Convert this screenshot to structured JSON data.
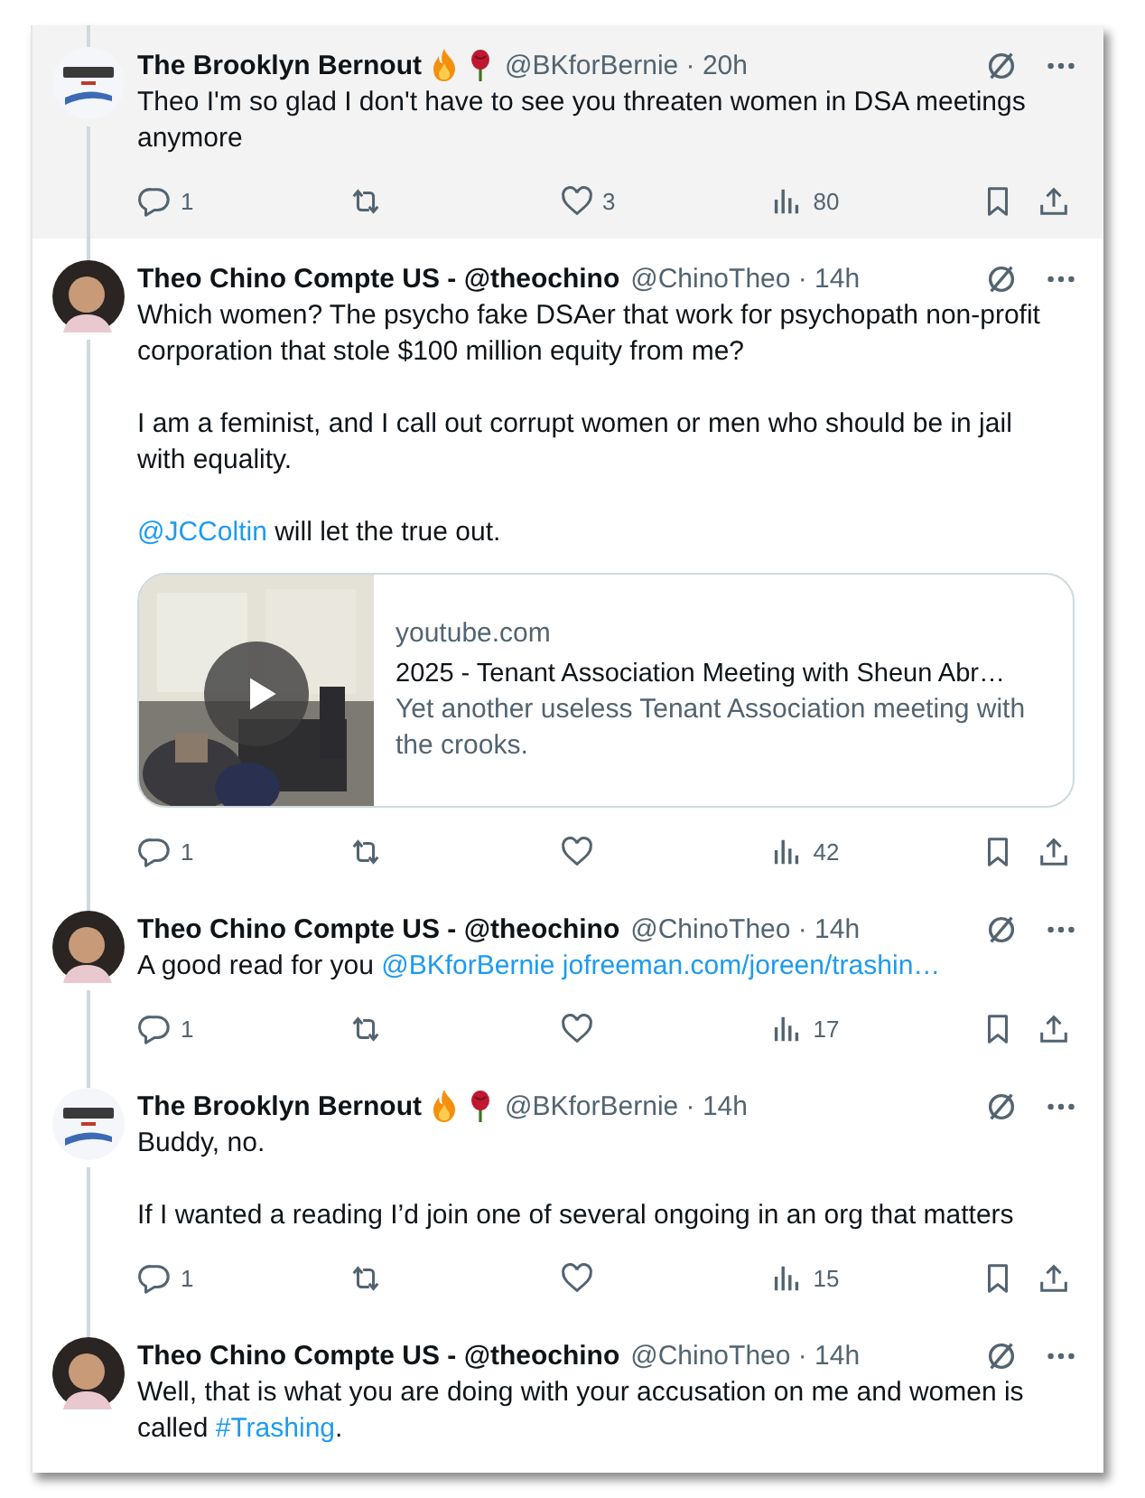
{
  "tweets": [
    {
      "avatar": {
        "kind": "logo"
      },
      "highlighted": true,
      "name": "The Brooklyn Bernout",
      "emojis": [
        {
          "kind": "flame"
        },
        {
          "kind": "rose"
        }
      ],
      "meta": "@BKforBernie · 20h",
      "body": [
        [
          {
            "kind": "text",
            "text": "Theo I'm so glad I don't have to see you threaten women in DSA meetings anymore"
          }
        ]
      ],
      "stats": {
        "replies": "1",
        "likes": "3",
        "views": "80"
      }
    },
    {
      "avatar": {
        "kind": "person"
      },
      "highlighted": false,
      "name": "Theo Chino Compte US - @theochino",
      "meta": "@ChinoTheo · 14h",
      "body": [
        [
          {
            "kind": "text",
            "text": "Which women? The psycho fake DSAer that work for psychopath non-profit corporation that stole $100 million equity from me?"
          }
        ],
        [
          {
            "kind": "text",
            "text": "I am a feminist, and I call out corrupt women or men who should be in jail with equality."
          }
        ],
        [
          {
            "kind": "mention",
            "text": "@JCColtin"
          },
          {
            "kind": "text",
            "text": " will let the true out."
          }
        ]
      ],
      "card": {
        "kind": "video",
        "domain": "youtube.com",
        "title": "2025 - Tenant Association Meeting with Sheun Abr…",
        "description": "Yet another useless Tenant Association meeting with the crooks."
      },
      "stats": {
        "replies": "1",
        "views": "42"
      }
    },
    {
      "avatar": {
        "kind": "person"
      },
      "highlighted": false,
      "name": "Theo Chino Compte US - @theochino",
      "meta": "@ChinoTheo · 14h",
      "body": [
        [
          {
            "kind": "text",
            "text": "A good read for you "
          },
          {
            "kind": "mention",
            "text": "@BKforBernie"
          },
          {
            "kind": "link",
            "text": "jofreeman.com/joreen/trashin…",
            "gap": true
          }
        ]
      ],
      "stats": {
        "replies": "1",
        "views": "17"
      }
    },
    {
      "avatar": {
        "kind": "logo"
      },
      "highlighted": false,
      "name": "The Brooklyn Bernout",
      "emojis": [
        {
          "kind": "flame"
        },
        {
          "kind": "rose"
        }
      ],
      "meta": "@BKforBernie · 14h",
      "body": [
        [
          {
            "kind": "text",
            "text": "Buddy, no."
          }
        ],
        [
          {
            "kind": "text",
            "text": "If I wanted a reading I’d join one of several ongoing in an org that matters"
          }
        ]
      ],
      "stats": {
        "replies": "1",
        "views": "15"
      }
    },
    {
      "avatar": {
        "kind": "person"
      },
      "highlighted": false,
      "name": "Theo Chino Compte US - @theochino",
      "meta": "@ChinoTheo · 14h",
      "body": [
        [
          {
            "kind": "text",
            "text": "Well, that is what you are doing with your accusation on me and women is called "
          },
          {
            "kind": "hashtag",
            "text": "#Trashing"
          },
          {
            "kind": "text",
            "text": "."
          }
        ]
      ]
    }
  ]
}
